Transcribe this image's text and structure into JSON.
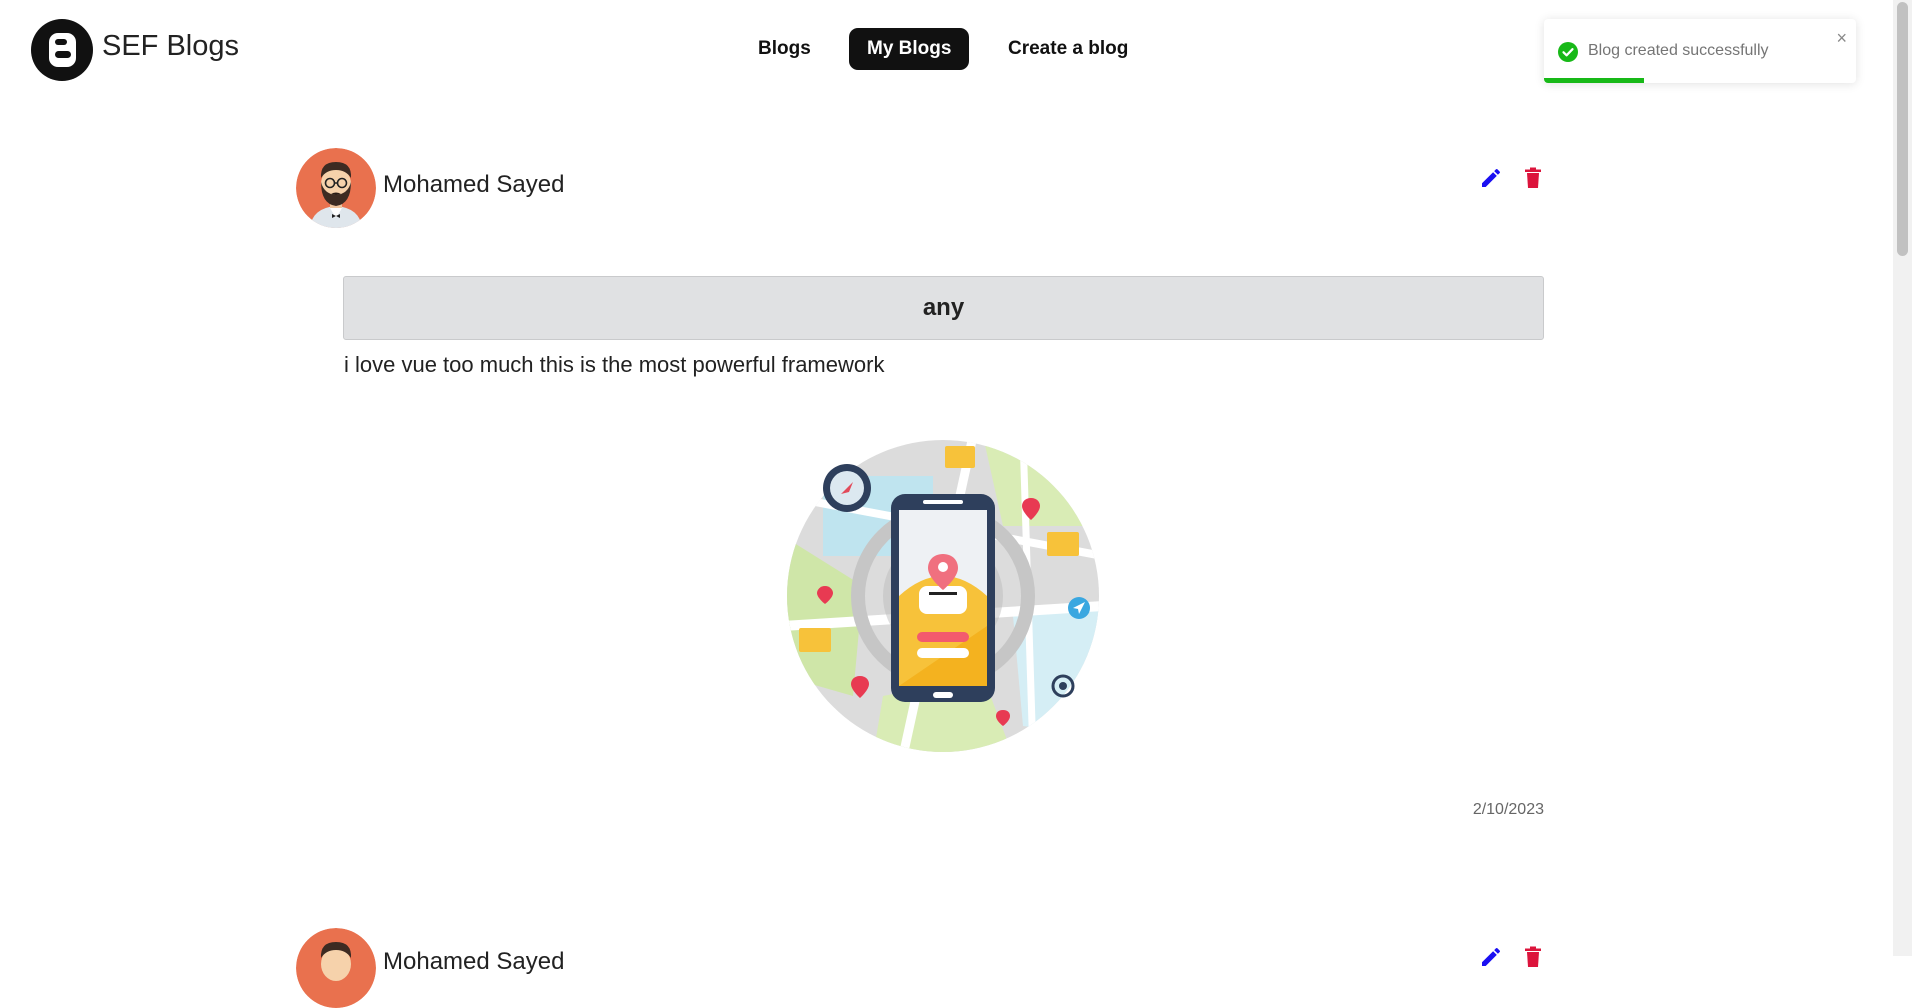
{
  "brand": {
    "name": "SEF Blogs",
    "logo_icon": "blogger-b-icon"
  },
  "nav": {
    "items": [
      {
        "label": "Blogs",
        "active": false
      },
      {
        "label": "My Blogs",
        "active": true
      },
      {
        "label": "Create a blog",
        "active": false
      }
    ]
  },
  "toast": {
    "message": "Blog created successfully",
    "close_glyph": "×",
    "status_icon": "check-circle-icon",
    "progress": 0.32,
    "colors": {
      "success": "#18b918"
    }
  },
  "posts": [
    {
      "author": "Mohamed Sayed",
      "title": "any",
      "body": "i love vue too much this is the most powerful framework",
      "date": "2/10/2023",
      "image_icon": "map-phone-illustration"
    },
    {
      "author": "Mohamed Sayed"
    }
  ],
  "colors": {
    "edit": "#1a0ff2",
    "delete": "#dc143c",
    "avatar_bg": "#e9714e",
    "nav_active": "#111111"
  }
}
